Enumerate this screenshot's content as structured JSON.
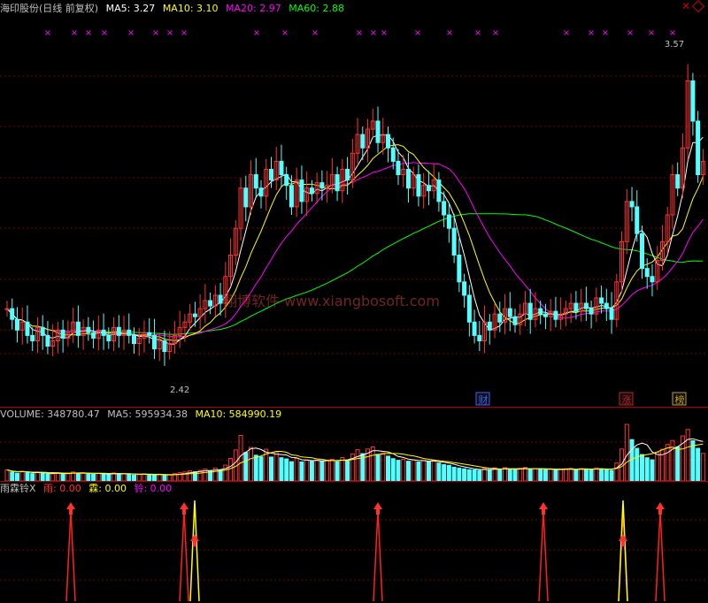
{
  "main_panel": {
    "title": "海印股份(日线 前复权)",
    "ma5_label": "MA5: 3.27",
    "ma10_label": "MA10: 3.10",
    "ma20_label": "MA20: 2.97",
    "ma60_label": "MA60: 2.88",
    "high_label": "3.57",
    "low_label": "2.42",
    "watermark": "翔博软件 www.xiangbosoft.com",
    "event_markers": [
      {
        "text": "财",
        "color": "#4060ff"
      },
      {
        "text": "涨",
        "color": "#c02020"
      },
      {
        "text": "榜",
        "color": "#c0a020"
      }
    ]
  },
  "volume_panel": {
    "volume_label": "VOLUME: 348780.47",
    "ma5_label": "MA5: 595934.38",
    "ma10_label": "MA10: 584990.19"
  },
  "indicator_panel": {
    "name_label": "雨霖铃X",
    "yu_label": "雨: 0.00",
    "lin_label": "霖: 0.00",
    "ling_label": "铃: 0.00"
  },
  "colors": {
    "up": "#ff3232",
    "down": "#54ffff",
    "ma5": "#ffffff",
    "ma10": "#ffff00",
    "ma20": "#ff00ff",
    "ma60": "#00ff00",
    "grid": "#7a0000",
    "marker": "#ff00ff"
  },
  "chart_data": {
    "type": "candlestick",
    "title": "海印股份(日线 前复权)",
    "price_range_visible": [
      2.42,
      3.57
    ],
    "price_high": 3.57,
    "price_low": 2.42,
    "ma": {
      "MA5": 3.27,
      "MA10": 3.1,
      "MA20": 2.97,
      "MA60": 2.88
    },
    "close": [
      2.6,
      2.56,
      2.52,
      2.55,
      2.5,
      2.48,
      2.53,
      2.5,
      2.46,
      2.48,
      2.52,
      2.49,
      2.51,
      2.55,
      2.5,
      2.53,
      2.51,
      2.49,
      2.52,
      2.5,
      2.48,
      2.53,
      2.5,
      2.52,
      2.5,
      2.47,
      2.49,
      2.51,
      2.5,
      2.45,
      2.48,
      2.44,
      2.47,
      2.5,
      2.53,
      2.55,
      2.58,
      2.57,
      2.6,
      2.63,
      2.61,
      2.65,
      2.62,
      2.72,
      2.8,
      2.9,
      3.05,
      2.98,
      3.1,
      3.05,
      3.02,
      3.12,
      3.08,
      3.15,
      3.1,
      3.06,
      2.98,
      3.08,
      3.0,
      3.05,
      3.03,
      3.07,
      3.05,
      3.06,
      3.1,
      3.04,
      3.12,
      3.08,
      3.18,
      3.25,
      3.2,
      3.27,
      3.3,
      3.22,
      3.25,
      3.2,
      3.15,
      3.1,
      3.12,
      3.05,
      3.1,
      3.02,
      3.06,
      3.04,
      3.08,
      3.0,
      2.95,
      2.9,
      2.8,
      2.7,
      2.65,
      2.55,
      2.5,
      2.48,
      2.55,
      2.52,
      2.58,
      2.55,
      2.6,
      2.57,
      2.54,
      2.58,
      2.62,
      2.56,
      2.6,
      2.58,
      2.57,
      2.59,
      2.56,
      2.58,
      2.6,
      2.62,
      2.59,
      2.62,
      2.6,
      2.58,
      2.64,
      2.62,
      2.6,
      2.56,
      2.7,
      2.85,
      3.0,
      2.98,
      2.88,
      2.75,
      2.72,
      2.7,
      2.78,
      2.85,
      2.95,
      3.1,
      3.05,
      3.2,
      3.45,
      3.3,
      3.1,
      3.15
    ],
    "volume": [
      4.8,
      3.9,
      3.4,
      4.2,
      3.6,
      3.2,
      3.8,
      3.4,
      3.0,
      3.1,
      3.6,
      3.3,
      3.2,
      3.9,
      3.4,
      3.6,
      3.1,
      2.9,
      3.3,
      3.0,
      2.8,
      3.5,
      3.1,
      3.2,
      2.9,
      2.6,
      2.8,
      3.1,
      2.9,
      2.5,
      2.8,
      2.4,
      2.7,
      3.2,
      3.6,
      3.9,
      4.4,
      4.0,
      4.6,
      5.2,
      4.5,
      5.6,
      4.8,
      6.9,
      9.8,
      13.5,
      19.8,
      12.4,
      14.6,
      11.2,
      10.5,
      13.8,
      10.4,
      12.6,
      10.1,
      9.6,
      8.4,
      9.8,
      8.3,
      9.2,
      8.5,
      9.1,
      8.6,
      8.8,
      9.4,
      8.4,
      10.2,
      9.1,
      11.8,
      13.6,
      11.9,
      13.9,
      14.8,
      11.6,
      12.2,
      10.8,
      9.7,
      9.0,
      9.4,
      8.6,
      9.2,
      8.3,
      8.8,
      8.4,
      8.9,
      7.8,
      7.1,
      6.8,
      6.0,
      5.6,
      5.3,
      4.9,
      4.8,
      4.6,
      5.4,
      5.0,
      5.7,
      5.1,
      5.8,
      5.2,
      4.9,
      5.5,
      5.9,
      5.0,
      5.4,
      5.1,
      4.9,
      5.2,
      4.8,
      5.0,
      5.3,
      5.5,
      5.0,
      5.4,
      5.1,
      4.9,
      5.7,
      5.3,
      5.0,
      4.6,
      7.8,
      13.9,
      24.6,
      18.0,
      14.2,
      11.5,
      10.1,
      9.2,
      12.4,
      13.8,
      15.9,
      17.6,
      14.8,
      19.6,
      22.4,
      17.5,
      14.2,
      12.0
    ]
  }
}
